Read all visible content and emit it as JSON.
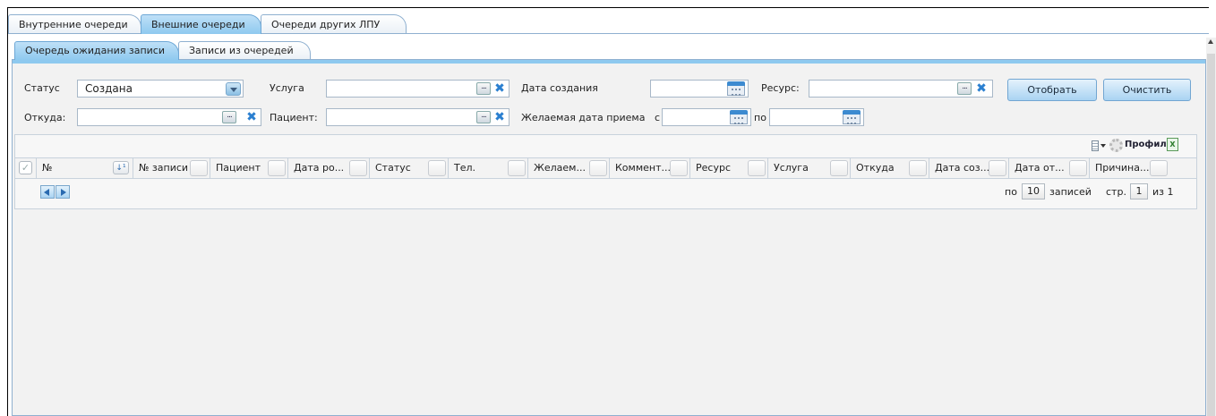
{
  "tabs_top": [
    "Внутренние очереди",
    "Внешние очереди",
    "Очереди других ЛПУ"
  ],
  "tabs_sub": [
    "Очередь ожидания записи",
    "Записи из очередей"
  ],
  "filters": {
    "status_label": "Статус",
    "status_value": "Создана",
    "service_label": "Услуга",
    "created_label": "Дата создания",
    "resource_label": "Ресурс:",
    "from_label": "Откуда:",
    "patient_label": "Пациент:",
    "desired_label": "Желаемая дата приема",
    "desired_from": "с",
    "desired_to": "по",
    "dots": "...",
    "clear_glyph": "✖"
  },
  "buttons": {
    "select": "Отобрать",
    "clear": "Очистить"
  },
  "toolbar": {
    "profile": "Профиль",
    "excel": "X"
  },
  "grid": {
    "check_glyph": "✓",
    "sort_glyph": "↓¹",
    "columns": [
      "№",
      "№ записи",
      "Пациент",
      "Дата ро...",
      "Статус",
      "Тел.",
      "Желаем...",
      "Коммент...",
      "Ресурс",
      "Услуга",
      "Откуда",
      "Дата соз...",
      "Дата от...",
      "Причина..."
    ]
  },
  "pager": {
    "per_prefix": "по",
    "per_value": "10",
    "per_suffix": "записей",
    "page_prefix": "стр.",
    "page_value": "1",
    "page_suffix": "из 1"
  }
}
